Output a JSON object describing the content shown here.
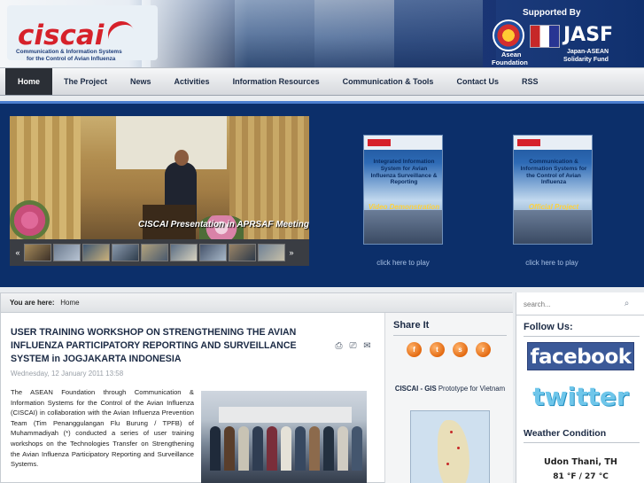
{
  "header": {
    "logo_text": "ciscai",
    "logo_sub1": "Communication & Information Systems",
    "logo_sub2": "for the Control of Avian Influenza",
    "supported_by": "Supported By",
    "asean_label1": "Asean",
    "asean_label2": "Foundation",
    "jasf_text": "JASF",
    "jasf_sub1": "Japan-ASEAN",
    "jasf_sub2": "Solidarity Fund"
  },
  "nav": {
    "items": [
      {
        "label": "Home",
        "active": true
      },
      {
        "label": "The Project"
      },
      {
        "label": "News"
      },
      {
        "label": "Activities"
      },
      {
        "label": "Information Resources"
      },
      {
        "label": "Communication & Tools"
      },
      {
        "label": "Contact Us"
      },
      {
        "label": "RSS"
      }
    ]
  },
  "showcase": {
    "slide_caption": "CISCAI Presentation in APRSAF Meeting",
    "video_cards": [
      {
        "title": "Integrated Information System for Avian Influenza Surveillance & Reporting",
        "band": "Video Demonstration",
        "link": "click here to play"
      },
      {
        "title": "Communication & Information Systems for the Control of Avian Influenza",
        "band": "Official Project Presentation",
        "link": "click here to play"
      }
    ]
  },
  "breadcrumb": {
    "prefix": "You are here:",
    "current": "Home"
  },
  "article": {
    "title": "USER TRAINING WORKSHOP ON STRENGTHENING THE AVIAN INFLUENZA PARTICIPATORY REPORTING AND SURVEILLANCE SYSTEM in JOGJAKARTA INDONESIA",
    "date": "Wednesday, 12 January 2011 13:58",
    "body": "The ASEAN Foundation through Communication & Information Systems for the Control of the Avian Influenza (CISCAI) in collaboration with the Avian Influenza Prevention Team (Tim Penanggulangan Flu Burung / TPFB) of Muhammadiyah (*) conducted a series of user training workshops on the Technologies Transfer on Strengthening the Avian Influenza Participatory Reporting and Surveillance Systems."
  },
  "share": {
    "title": "Share It",
    "icons": [
      "facebook-share-icon",
      "twitter-share-icon",
      "stumbleupon-share-icon",
      "rss-share-icon"
    ],
    "gis_bold": "CISCAI - GIS",
    "gis_rest": "Prototype for Vietnam"
  },
  "sidebar": {
    "search_placeholder": "search...",
    "follow_title": "Follow Us:",
    "facebook_label": "facebook",
    "twitter_label": "twitter",
    "weather_title": "Weather Condition",
    "weather_city": "Udon Thani, TH",
    "weather_temp": "81 °F / 27 °C"
  },
  "colors": {
    "brand_red": "#d6212a",
    "nav_active": "#2b2f36",
    "showcase_bg": "#0c2f6a",
    "heading": "#1b2a44"
  }
}
